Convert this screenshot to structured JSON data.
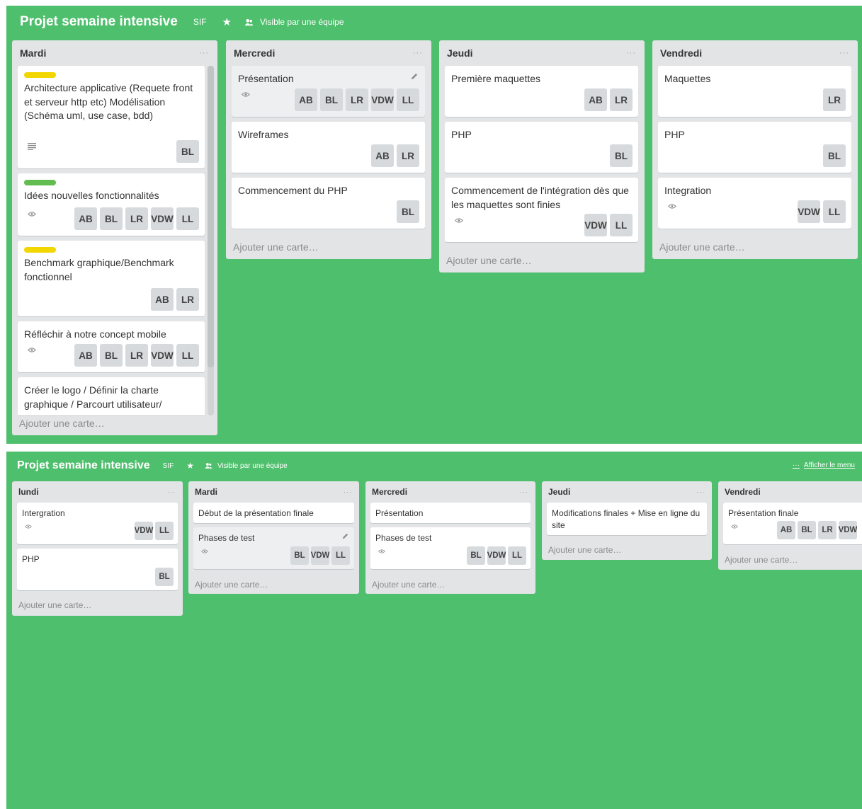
{
  "colors": {
    "board_bg": "#4ebf6c",
    "list_bg": "#e2e4e6",
    "label_yellow": "#f2d600",
    "label_green": "#61bd4f"
  },
  "list_menu": "···",
  "add_card_label": "Ajouter une carte…",
  "board1": {
    "header": {
      "title": "Projet semaine intensive",
      "org": "SIF",
      "visibility": "Visible par une équipe"
    },
    "lists": [
      {
        "title": "Mardi",
        "cards": [
          {
            "title": "Architecture applicative (Requete front et serveur http etc) Modélisation (Schéma uml, use case, bdd)",
            "label": "yellow",
            "members": [
              "BL"
            ]
          },
          {
            "title": "Idées nouvelles fonctionnalités",
            "label": "green",
            "members": [
              "AB",
              "BL",
              "LR",
              "VDW",
              "LL"
            ]
          },
          {
            "title": "Benchmark graphique/Benchmark fonctionnel",
            "label": "yellow",
            "members": [
              "AB",
              "LR"
            ]
          },
          {
            "title": "Réfléchir à notre concept mobile",
            "members": [
              "AB",
              "BL",
              "LR",
              "VDW",
              "LL"
            ]
          },
          {
            "title": "Créer le logo / Définir la charte graphique / Parcourt utilisateur/",
            "members": []
          }
        ]
      },
      {
        "title": "Mercredi",
        "cards": [
          {
            "title": "Présentation",
            "members": [
              "AB",
              "BL",
              "LR",
              "VDW",
              "LL"
            ]
          },
          {
            "title": "Wireframes",
            "members": [
              "AB",
              "LR"
            ]
          },
          {
            "title": "Commencement du PHP",
            "members": [
              "BL"
            ]
          }
        ]
      },
      {
        "title": "Jeudi",
        "cards": [
          {
            "title": "Première maquettes",
            "members": [
              "AB",
              "LR"
            ]
          },
          {
            "title": "PHP",
            "members": [
              "BL"
            ]
          },
          {
            "title": "Commencement de l'intégration dès que les maquettes sont finies",
            "members": [
              "VDW",
              "LL"
            ]
          }
        ]
      },
      {
        "title": "Vendredi",
        "cards": [
          {
            "title": "Maquettes",
            "members": [
              "LR"
            ]
          },
          {
            "title": "PHP",
            "members": [
              "BL"
            ]
          },
          {
            "title": "Integration",
            "members": [
              "VDW",
              "LL"
            ]
          }
        ]
      }
    ]
  },
  "board2": {
    "header": {
      "title": "Projet semaine intensive",
      "org": "SIF",
      "visibility": "Visible par une équipe",
      "menu": "Afficher le menu"
    },
    "lists": [
      {
        "title": "lundi",
        "cards": [
          {
            "title": "Intergration",
            "members": [
              "VDW",
              "LL"
            ]
          },
          {
            "title": "PHP",
            "members": [
              "BL"
            ]
          }
        ]
      },
      {
        "title": "Mardi",
        "cards": [
          {
            "title": "Début de la présentation finale",
            "members": []
          },
          {
            "title": "Phases de test",
            "members": [
              "BL",
              "VDW",
              "LL"
            ]
          }
        ]
      },
      {
        "title": "Mercredi",
        "cards": [
          {
            "title": "Présentation",
            "members": []
          },
          {
            "title": "Phases de test",
            "members": [
              "BL",
              "VDW",
              "LL"
            ]
          }
        ]
      },
      {
        "title": "Jeudi",
        "cards": [
          {
            "title": "Modifications finales + Mise en ligne du site",
            "members": []
          }
        ]
      },
      {
        "title": "Vendredi",
        "cards": [
          {
            "title": "Présentation finale",
            "members": [
              "AB",
              "BL",
              "LR",
              "VDW"
            ]
          }
        ]
      }
    ]
  }
}
